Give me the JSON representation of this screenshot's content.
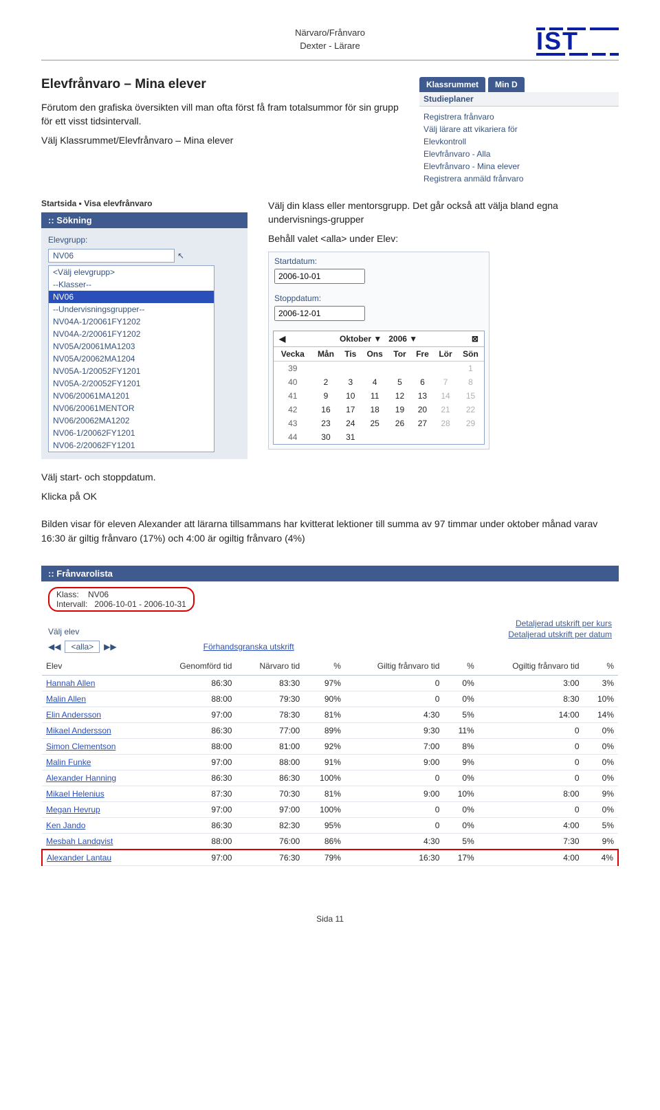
{
  "header": {
    "line1": "Närvaro/Frånvaro",
    "line2": "Dexter - Lärare"
  },
  "title": "Elevfrånvaro – Mina elever",
  "intro1": "Förutom den grafiska översikten vill man ofta först få fram totalsummor för sin grupp för ett visst tidsintervall.",
  "intro2": "Välj Klassrummet/Elevfrånvaro – Mina elever",
  "menu": {
    "tab1": "Klassrummet",
    "tab2": "Min D",
    "head": "Studieplaner",
    "items": [
      "Registrera frånvaro",
      "Välj lärare att vikariera för",
      "Elevkontroll",
      "Elevfrånvaro - Alla",
      "Elevfrånvaro - Mina elever",
      "Registrera anmäld frånvaro"
    ]
  },
  "breadcrumbs": "Startsida ▪ Visa elevfrånvaro",
  "sokning": {
    "title": ":: Sökning",
    "label": "Elevgrupp:",
    "selected": "NV06",
    "options": [
      "<Välj elevgrupp>",
      "--Klasser--",
      "NV06",
      "--Undervisningsgrupper--",
      "NV04A-1/20061FY1202",
      "NV04A-2/20061FY1202",
      "NV05A/20061MA1203",
      "NV05A/20062MA1204",
      "NV05A-1/20052FY1201",
      "NV05A-2/20052FY1201",
      "NV06/20061MA1201",
      "NV06/20061MENTOR",
      "NV06/20062MA1202",
      "NV06-1/20062FY1201",
      "NV06-2/20062FY1201"
    ]
  },
  "right_text1": "Välj din klass eller mentorsgrupp. Det går också att välja bland egna undervisnings-grupper",
  "right_text2": "Behåll valet <alla> under Elev:",
  "dates": {
    "start_label": "Startdatum:",
    "start_value": "2006-10-01",
    "stop_label": "Stoppdatum:",
    "stop_value": "2006-12-01"
  },
  "calendar": {
    "month": "Oktober",
    "year": "2006",
    "days": [
      "Vecka",
      "Mån",
      "Tis",
      "Ons",
      "Tor",
      "Fre",
      "Lör",
      "Sön"
    ],
    "weeks": [
      {
        "wk": "39",
        "d": [
          "",
          "",
          "",
          "",
          "",
          "",
          "1"
        ],
        "muted": [
          6
        ]
      },
      {
        "wk": "40",
        "d": [
          "2",
          "3",
          "4",
          "5",
          "6",
          "7",
          "8"
        ],
        "muted": [
          5,
          6
        ]
      },
      {
        "wk": "41",
        "d": [
          "9",
          "10",
          "11",
          "12",
          "13",
          "14",
          "15"
        ],
        "muted": [
          5,
          6
        ]
      },
      {
        "wk": "42",
        "d": [
          "16",
          "17",
          "18",
          "19",
          "20",
          "21",
          "22"
        ],
        "muted": [
          5,
          6
        ]
      },
      {
        "wk": "43",
        "d": [
          "23",
          "24",
          "25",
          "26",
          "27",
          "28",
          "29"
        ],
        "muted": [
          5,
          6
        ]
      },
      {
        "wk": "44",
        "d": [
          "30",
          "31",
          "",
          "",
          "",
          "",
          ""
        ],
        "muted": []
      }
    ]
  },
  "mid_text1": "Välj start- och stoppdatum.",
  "mid_text2": "Klicka på OK",
  "mid_text3": "Bilden visar för eleven Alexander att lärarna tillsammans har kvitterat lektioner till summa av 97 timmar under oktober månad varav 16:30 är giltig frånvaro (17%) och 4:00 är ogiltig frånvaro (4%)",
  "list": {
    "title": ":: Frånvarolista",
    "klass_label": "Klass:",
    "klass_value": "NV06",
    "intervall_label": "Intervall:",
    "intervall_value": "2006-10-01 - 2006-10-31",
    "valj_elev": "Välj elev",
    "alla": "<alla>",
    "forhand": "Förhandsgranska utskrift",
    "detalj1": "Detaljerad utskrift per kurs",
    "detalj2": "Detaljerad utskrift per datum",
    "cols": [
      "Elev",
      "Genomförd tid",
      "Närvaro tid",
      "%",
      "Giltig frånvaro tid",
      "%",
      "Ogiltig frånvaro tid",
      "%"
    ],
    "rows": [
      {
        "name": "Hannah Allen",
        "g": "86:30",
        "n": "83:30",
        "np": "97%",
        "gf": "0",
        "gfp": "0%",
        "og": "3:00",
        "ogp": "3%"
      },
      {
        "name": "Malin Allen",
        "g": "88:00",
        "n": "79:30",
        "np": "90%",
        "gf": "0",
        "gfp": "0%",
        "og": "8:30",
        "ogp": "10%"
      },
      {
        "name": "Elin Andersson",
        "g": "97:00",
        "n": "78:30",
        "np": "81%",
        "gf": "4:30",
        "gfp": "5%",
        "og": "14:00",
        "ogp": "14%"
      },
      {
        "name": "Mikael Andersson",
        "g": "86:30",
        "n": "77:00",
        "np": "89%",
        "gf": "9:30",
        "gfp": "11%",
        "og": "0",
        "ogp": "0%"
      },
      {
        "name": "Simon Clementson",
        "g": "88:00",
        "n": "81:00",
        "np": "92%",
        "gf": "7:00",
        "gfp": "8%",
        "og": "0",
        "ogp": "0%"
      },
      {
        "name": "Malin Funke",
        "g": "97:00",
        "n": "88:00",
        "np": "91%",
        "gf": "9:00",
        "gfp": "9%",
        "og": "0",
        "ogp": "0%"
      },
      {
        "name": "Alexander Hanning",
        "g": "86:30",
        "n": "86:30",
        "np": "100%",
        "gf": "0",
        "gfp": "0%",
        "og": "0",
        "ogp": "0%"
      },
      {
        "name": "Mikael Helenius",
        "g": "87:30",
        "n": "70:30",
        "np": "81%",
        "gf": "9:00",
        "gfp": "10%",
        "og": "8:00",
        "ogp": "9%"
      },
      {
        "name": "Megan Hevrup",
        "g": "97:00",
        "n": "97:00",
        "np": "100%",
        "gf": "0",
        "gfp": "0%",
        "og": "0",
        "ogp": "0%"
      },
      {
        "name": "Ken Jando",
        "g": "86:30",
        "n": "82:30",
        "np": "95%",
        "gf": "0",
        "gfp": "0%",
        "og": "4:00",
        "ogp": "5%"
      },
      {
        "name": "Mesbah Landqvist",
        "g": "88:00",
        "n": "76:00",
        "np": "86%",
        "gf": "4:30",
        "gfp": "5%",
        "og": "7:30",
        "ogp": "9%"
      },
      {
        "name": "Alexander Lantau",
        "g": "97:00",
        "n": "76:30",
        "np": "79%",
        "gf": "16:30",
        "gfp": "17%",
        "og": "4:00",
        "ogp": "4%",
        "hl": true
      }
    ]
  },
  "chart_data": {
    "type": "table",
    "title": "Frånvarolista NV06 2006-10-01 – 2006-10-31",
    "columns": [
      "Elev",
      "Genomförd tid",
      "Närvaro tid",
      "Närvaro %",
      "Giltig frånvaro tid",
      "Giltig %",
      "Ogiltig frånvaro tid",
      "Ogiltig %"
    ],
    "rows": [
      [
        "Hannah Allen",
        "86:30",
        "83:30",
        97,
        "0",
        0,
        "3:00",
        3
      ],
      [
        "Malin Allen",
        "88:00",
        "79:30",
        90,
        "0",
        0,
        "8:30",
        10
      ],
      [
        "Elin Andersson",
        "97:00",
        "78:30",
        81,
        "4:30",
        5,
        "14:00",
        14
      ],
      [
        "Mikael Andersson",
        "86:30",
        "77:00",
        89,
        "9:30",
        11,
        "0",
        0
      ],
      [
        "Simon Clementson",
        "88:00",
        "81:00",
        92,
        "7:00",
        8,
        "0",
        0
      ],
      [
        "Malin Funke",
        "97:00",
        "88:00",
        91,
        "9:00",
        9,
        "0",
        0
      ],
      [
        "Alexander Hanning",
        "86:30",
        "86:30",
        100,
        "0",
        0,
        "0",
        0
      ],
      [
        "Mikael Helenius",
        "87:30",
        "70:30",
        81,
        "9:00",
        10,
        "8:00",
        9
      ],
      [
        "Megan Hevrup",
        "97:00",
        "97:00",
        100,
        "0",
        0,
        "0",
        0
      ],
      [
        "Ken Jando",
        "86:30",
        "82:30",
        95,
        "0",
        0,
        "4:00",
        5
      ],
      [
        "Mesbah Landqvist",
        "88:00",
        "76:00",
        86,
        "4:30",
        5,
        "7:30",
        9
      ],
      [
        "Alexander Lantau",
        "97:00",
        "76:30",
        79,
        "16:30",
        17,
        "4:00",
        4
      ]
    ]
  },
  "footer": "Sida 11"
}
